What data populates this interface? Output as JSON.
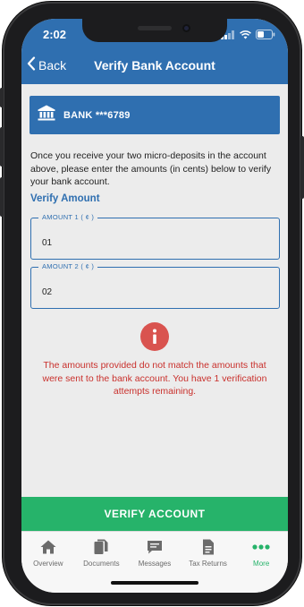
{
  "status_bar": {
    "time": "2:02",
    "icons": [
      "signal-icon",
      "wifi-icon",
      "battery-icon"
    ]
  },
  "nav": {
    "back_label": "Back",
    "title": "Verify Bank Account"
  },
  "bank": {
    "icon": "bank-icon",
    "label": "BANK ***6789"
  },
  "instructions": "Once you receive your two micro-deposits in the account above, please enter the amounts (in cents) below to verify your bank account.",
  "verify_section_title": "Verify Amount",
  "fields": [
    {
      "legend": "AMOUNT 1 ( ¢ )",
      "value": "01"
    },
    {
      "legend": "AMOUNT 2 ( ¢ )",
      "value": "02"
    }
  ],
  "error": {
    "icon": "info-icon",
    "message": "The amounts provided do not match the amounts that were sent to the bank account. You have 1 verification attempts remaining."
  },
  "verify_button_label": "VERIFY ACCOUNT",
  "tabs": [
    {
      "label": "Overview",
      "icon": "home-icon",
      "active": false
    },
    {
      "label": "Documents",
      "icon": "documents-icon",
      "active": false
    },
    {
      "label": "Messages",
      "icon": "messages-icon",
      "active": false
    },
    {
      "label": "Tax Returns",
      "icon": "tax-returns-icon",
      "active": false
    },
    {
      "label": "More",
      "icon": "more-icon",
      "active": true
    }
  ],
  "colors": {
    "primary": "#2f6fb0",
    "success": "#26b36a",
    "error": "#d9534f",
    "background": "#ececec"
  }
}
